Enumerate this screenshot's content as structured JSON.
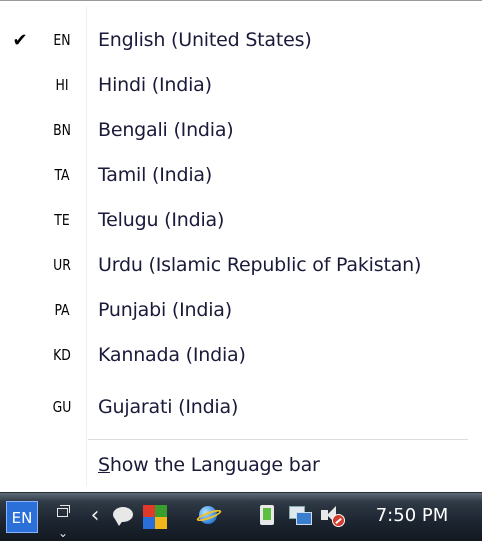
{
  "language_menu": {
    "items": [
      {
        "code": "EN",
        "label": "English (United States)",
        "checked": true
      },
      {
        "code": "HI",
        "label": "Hindi (India)",
        "checked": false
      },
      {
        "code": "BN",
        "label": "Bengali (India)",
        "checked": false
      },
      {
        "code": "TA",
        "label": "Tamil (India)",
        "checked": false
      },
      {
        "code": "TE",
        "label": "Telugu (India)",
        "checked": false
      },
      {
        "code": "UR",
        "label": "Urdu (Islamic Republic of Pakistan)",
        "checked": false
      },
      {
        "code": "PA",
        "label": "Punjabi (India)",
        "checked": false
      },
      {
        "code": "KD",
        "label": "Kannada (India)",
        "checked": false
      },
      {
        "code": "GU",
        "label": "Gujarati (India)",
        "checked": false
      }
    ],
    "check_glyph": "✔",
    "show_bar": {
      "mnemonic": "S",
      "rest": "how the Language bar"
    }
  },
  "taskbar": {
    "language_button": "EN",
    "clock": "7:50 PM",
    "tray_icons": [
      "restore-icon",
      "arrow-icon",
      "chat-icon",
      "color-icon",
      "globe-icon",
      "power-icon",
      "network-icon",
      "volume-icon"
    ]
  },
  "colors": {
    "menu_text": "#1a1a3a",
    "taskbar_bg": "#1c2530",
    "language_button_bg": "#2b6fd8"
  }
}
